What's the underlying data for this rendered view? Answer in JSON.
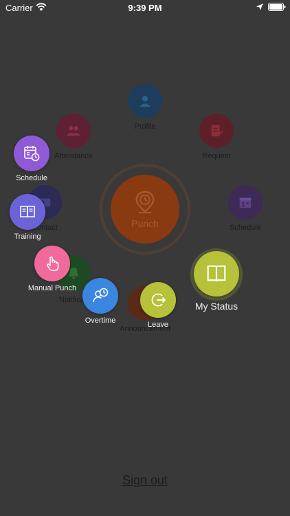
{
  "status_bar": {
    "carrier": "Carrier",
    "time": "9:39 PM"
  },
  "background_menu": {
    "items": [
      {
        "label": "Profile",
        "color": "#1e3d5c",
        "icon": "person-icon"
      },
      {
        "label": "Attendance",
        "color": "#5e2032",
        "icon": "group-icon"
      },
      {
        "label": "Request",
        "color": "#5e2028",
        "icon": "document-edit-icon"
      },
      {
        "label": "Contact",
        "color": "#2c2a57",
        "icon": "contact-card-icon"
      },
      {
        "label": "Schedule",
        "color": "#3d2a57",
        "icon": "calendar-icon"
      },
      {
        "label": "Notificati",
        "color": "#1d4a22",
        "icon": "bell-icon"
      },
      {
        "label": "Announcement",
        "color": "#5a2a16",
        "icon": "announcement-icon"
      }
    ],
    "center": {
      "label": "Punch",
      "color": "#8a3a10",
      "icon": "location-clock-icon"
    }
  },
  "foreground_menu": {
    "items": [
      {
        "label": "Schedule",
        "color": "#8e5ad8",
        "icon": "calendar-clock-icon"
      },
      {
        "label": "Training",
        "color": "#6d63d8",
        "icon": "open-book-icon"
      },
      {
        "label": "Manual Punch",
        "color": "#f06a9c",
        "icon": "tap-hand-icon"
      },
      {
        "label": "Overtime",
        "color": "#3a86e0",
        "icon": "person-clock-icon"
      },
      {
        "label": "Leave",
        "color": "#b5c23a",
        "icon": "exit-icon"
      },
      {
        "label": "My Status",
        "color": "#b5c23a",
        "icon": "book-icon"
      }
    ]
  },
  "footer": {
    "sign_out": "Sign out"
  }
}
